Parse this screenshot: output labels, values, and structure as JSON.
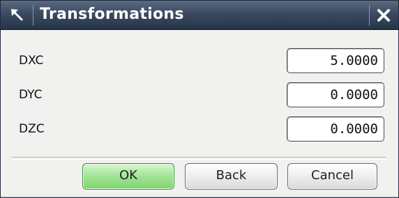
{
  "window": {
    "title": "Transformations",
    "pin_icon": "pin-arrow-icon",
    "close_icon": "close-icon"
  },
  "fields": [
    {
      "label": "DXC",
      "value": "5.0000"
    },
    {
      "label": "DYC",
      "value": "0.0000"
    },
    {
      "label": "DZC",
      "value": "0.0000"
    }
  ],
  "buttons": {
    "ok": "OK",
    "back": "Back",
    "cancel": "Cancel"
  },
  "colors": {
    "titlebar": "#3b4a60",
    "ok_button": "#9ce28f",
    "dialog_bg": "#f1f1ef"
  }
}
